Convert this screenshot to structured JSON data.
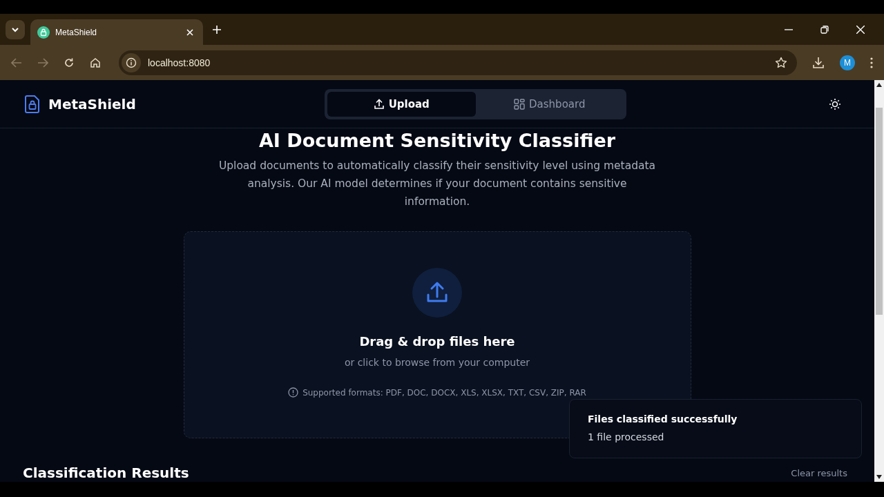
{
  "browser": {
    "tabs": [
      {
        "title": "MetaShield",
        "selected": true
      }
    ],
    "url": "localhost:8080",
    "profile_initial": "M"
  },
  "header": {
    "brand": "MetaShield",
    "nav": [
      {
        "label": "Upload",
        "kind": "upload",
        "selected": true
      },
      {
        "label": "Dashboard",
        "kind": "dashboard",
        "selected": false
      }
    ]
  },
  "title": "AI Document Sensitivity Classifier",
  "description": "Upload documents to automatically classify their sensitivity level using metadata analysis. Our AI model determines if your document contains sensitive information.",
  "dropzone": {
    "heading": "Drag & drop files here",
    "subtext": "or click to browse from your computer",
    "formats": "Supported formats: PDF, DOC, DOCX, XLS, XLSX, TXT, CSV, ZIP, RAR"
  },
  "results": {
    "heading": "Classification Results",
    "clear": "Clear results"
  },
  "toast": {
    "title": "Files classified successfully",
    "message": "1 file processed"
  }
}
